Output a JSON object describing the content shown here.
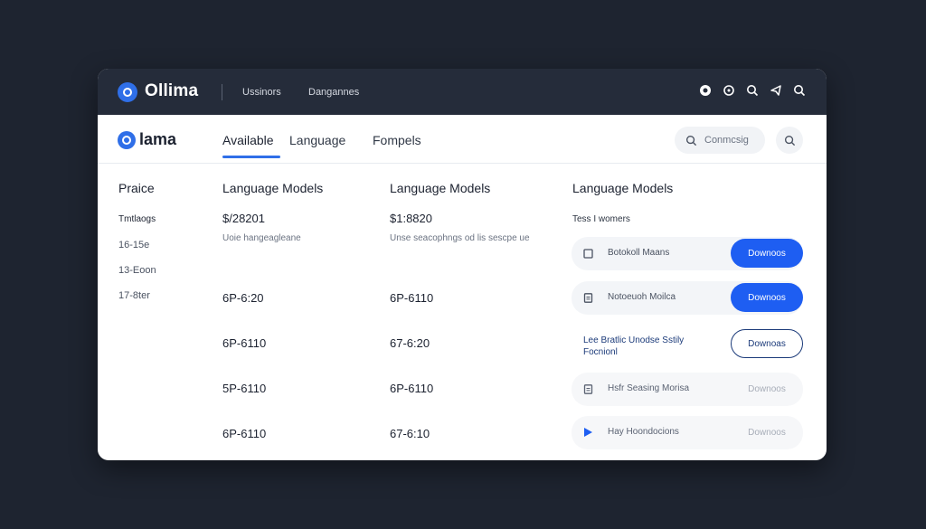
{
  "titlebar": {
    "brand": "Ollima",
    "nav": [
      "Ussinors",
      "Dangannes"
    ],
    "icons": [
      "record-icon",
      "circle-icon",
      "search-icon",
      "send-icon",
      "search-icon"
    ]
  },
  "header": {
    "brand": "lama",
    "tabs": [
      {
        "label": "Available",
        "active": true
      },
      {
        "label": "Language",
        "active": false
      },
      {
        "label": "Fompels",
        "active": false
      }
    ],
    "search_placeholder": "Conmcsig"
  },
  "sidebar": {
    "title": "Praice",
    "items": [
      "Tmtlaogs",
      "16-15e",
      "13-Eoon",
      "17-8ter"
    ]
  },
  "columns": [
    {
      "title": "Language Models",
      "price": "$/28201",
      "desc": "Uoie hangeagleane",
      "values": [
        "6P-6:20",
        "6P-6110",
        "5P-6110",
        "6P-6110"
      ]
    },
    {
      "title": "Language Models",
      "price": "$1:8820",
      "desc": "Unse seacophngs od lis sescpe ue",
      "values": [
        "6P-6110",
        "67-6:20",
        "6P-6110",
        "67-6:10"
      ]
    }
  ],
  "right": {
    "title": "Language Models",
    "subtitle": "Tess I womers",
    "rows": [
      {
        "label": "Botokoll Maans",
        "button": "Downoos",
        "style": "primary",
        "icon": "square-icon"
      },
      {
        "label": "Notoeuoh Moilca",
        "button": "Downoos",
        "style": "primary",
        "icon": "doc-icon"
      },
      {
        "label": "Lee Bratlic Unodse Sstily Focnionl",
        "button": "Downoas",
        "style": "outline",
        "icon": ""
      },
      {
        "label": "Hsfr Seasing Morisa",
        "button": "Downoos",
        "style": "muted",
        "icon": "doc-icon"
      },
      {
        "label": "Hay Hoondocions",
        "button": "Downoos",
        "style": "muted",
        "icon": "play-icon"
      }
    ]
  },
  "colors": {
    "accent": "#1e5ef2",
    "titlebar": "#252c3a",
    "background": "#1e2430"
  }
}
